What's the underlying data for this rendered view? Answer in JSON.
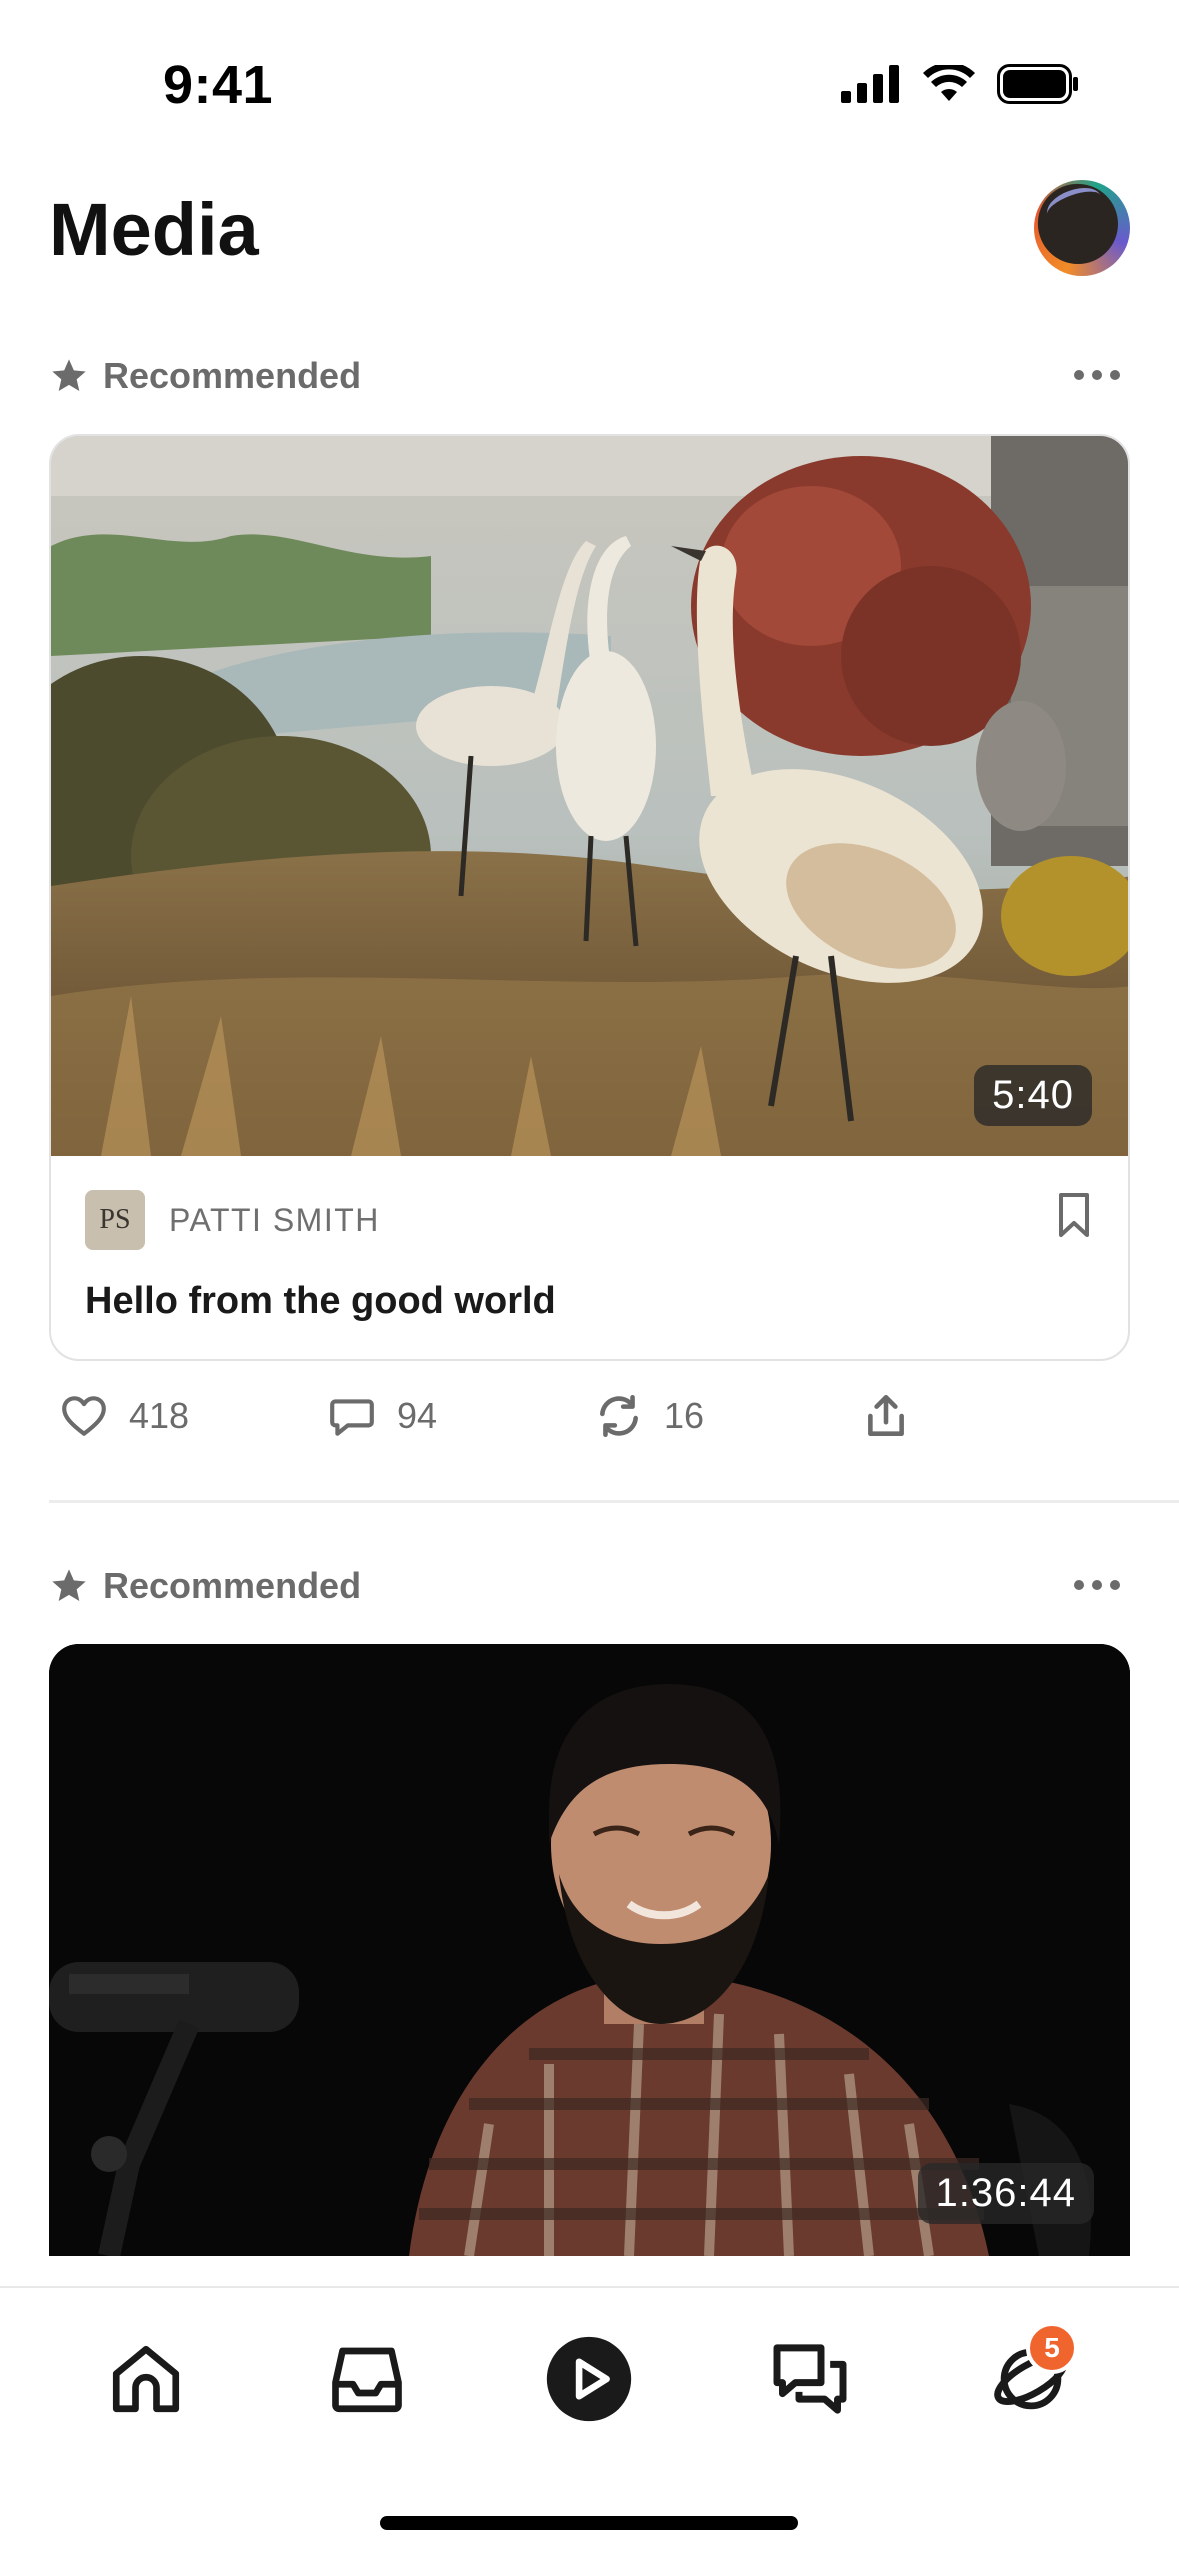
{
  "status_bar": {
    "time": "9:41"
  },
  "header": {
    "title": "Media"
  },
  "posts": [
    {
      "label": "Recommended",
      "duration": "5:40",
      "author_initials": "PS",
      "author_name": "PATTI SMITH",
      "title": "Hello from the good world",
      "likes": "418",
      "comments": "94",
      "restacks": "16"
    },
    {
      "label": "Recommended",
      "duration": "1:36:44"
    }
  ],
  "tab_bar": {
    "items": [
      "home-icon",
      "inbox-icon",
      "play-icon",
      "chat-icon",
      "activity-icon"
    ],
    "activity_badge": "5"
  },
  "colors": {
    "accent": "#f0642d",
    "muted": "#6b6b6b",
    "divider": "#ececec"
  }
}
